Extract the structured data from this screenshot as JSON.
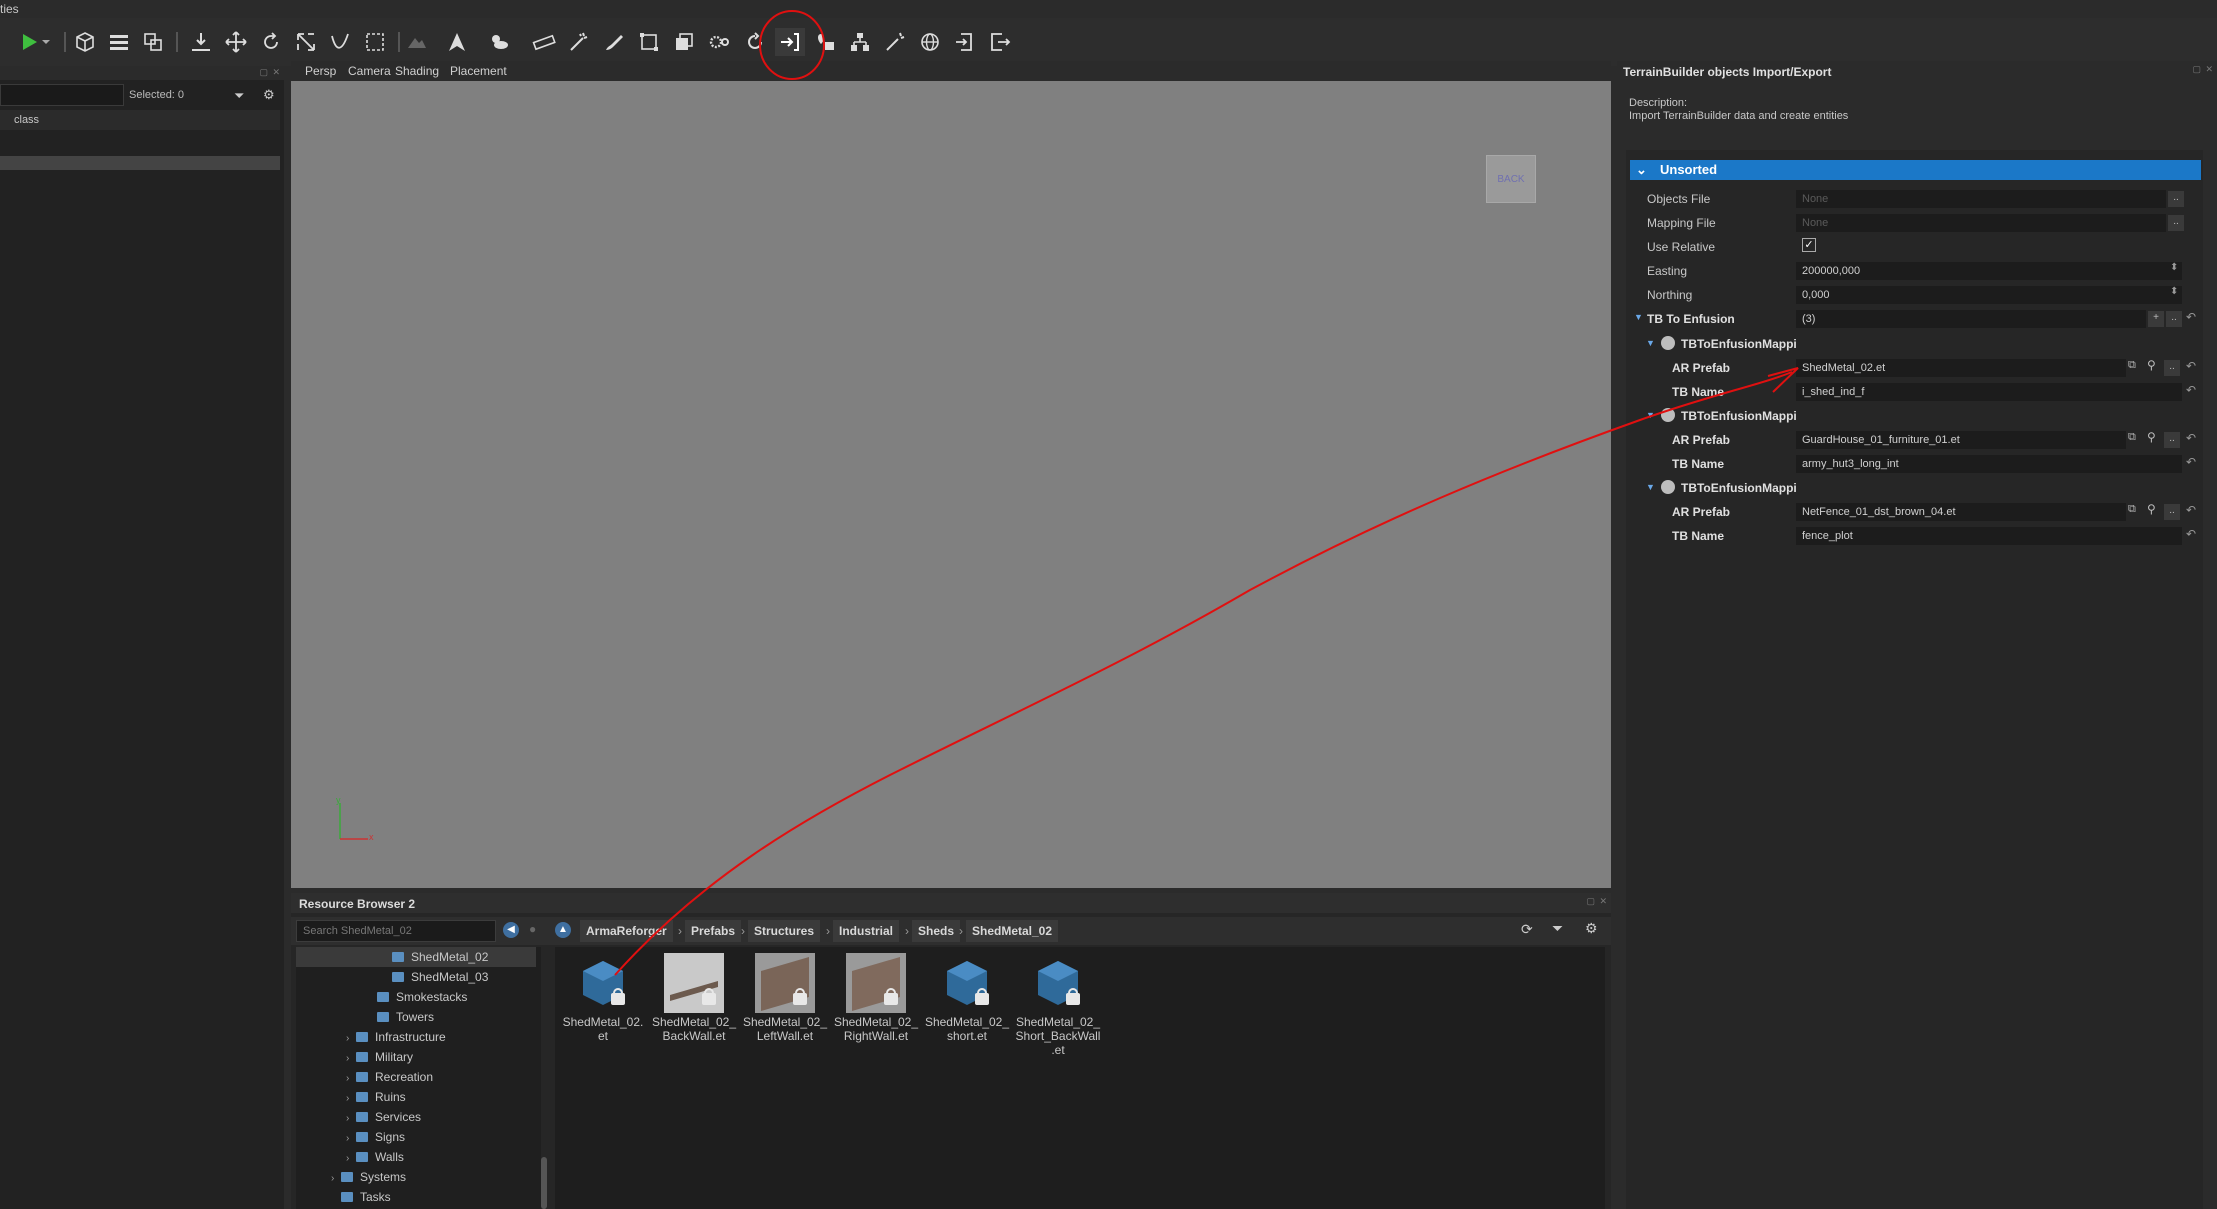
{
  "app": {
    "title_fragment": "ties"
  },
  "colors": {
    "accent": "#1b78c8",
    "annotation": "#e01010",
    "viewport_bg": "#808080"
  },
  "outliner": {
    "selected_label": "Selected: 0",
    "column_header": "class"
  },
  "viewport": {
    "tabs": [
      "Persp",
      "Camera",
      "Shading",
      "Placement"
    ],
    "navcube_label": "BACK",
    "axis_y": "y",
    "axis_x": "x"
  },
  "resource_browser": {
    "title": "Resource Browser 2",
    "search_placeholder": "Search ShedMetal_02",
    "breadcrumb": [
      "ArmaReforger",
      "Prefabs",
      "Structures",
      "Industrial",
      "Sheds",
      "ShedMetal_02"
    ],
    "tree": [
      {
        "label": "ShedMetal_02",
        "selected": true
      },
      {
        "label": "ShedMetal_03"
      },
      {
        "label": "Smokestacks"
      },
      {
        "label": "Towers"
      },
      {
        "label": "Infrastructure"
      },
      {
        "label": "Military"
      },
      {
        "label": "Recreation"
      },
      {
        "label": "Ruins"
      },
      {
        "label": "Services"
      },
      {
        "label": "Signs"
      },
      {
        "label": "Walls"
      },
      {
        "label": "Systems"
      },
      {
        "label": "Tasks"
      }
    ],
    "assets": [
      {
        "line1": "ShedMetal_02.",
        "line2": "et",
        "line3": "",
        "icon": "prefab-cube-icon"
      },
      {
        "line1": "ShedMetal_02_",
        "line2": "BackWall.et",
        "line3": "",
        "icon": "wall-thumbnail"
      },
      {
        "line1": "ShedMetal_02_",
        "line2": "LeftWall.et",
        "line3": "",
        "icon": "wall-thumbnail"
      },
      {
        "line1": "ShedMetal_02_",
        "line2": "RightWall.et",
        "line3": "",
        "icon": "wall-thumbnail"
      },
      {
        "line1": "ShedMetal_02_",
        "line2": "short.et",
        "line3": "",
        "icon": "prefab-cube-icon"
      },
      {
        "line1": "ShedMetal_02_",
        "line2": "Short_BackWall",
        "line3": ".et",
        "icon": "prefab-cube-icon"
      }
    ]
  },
  "tb_panel": {
    "title": "TerrainBuilder objects Import/Export",
    "description_label": "Description:",
    "description_text": "Import TerrainBuilder data and create entities",
    "section": "Unsorted",
    "objects_file_label": "Objects File",
    "objects_file_value": "None",
    "mapping_file_label": "Mapping File",
    "mapping_file_value": "None",
    "use_relative_label": "Use Relative",
    "use_relative_checked": true,
    "easting_label": "Easting",
    "easting_value": "200000,000",
    "northing_label": "Northing",
    "northing_value": "0,000",
    "tb_to_enfusion_label": "TB To Enfusion",
    "tb_to_enfusion_count": "(3)",
    "mappings": [
      {
        "header": "TBToEnfusionMappi",
        "ar_label": "AR Prefab",
        "ar_value": "ShedMetal_02.et",
        "tb_label": "TB Name",
        "tb_value": "i_shed_ind_f"
      },
      {
        "header": "TBToEnfusionMappi",
        "ar_label": "AR Prefab",
        "ar_value": "GuardHouse_01_furniture_01.et",
        "tb_label": "TB Name",
        "tb_value": "army_hut3_long_int"
      },
      {
        "header": "TBToEnfusionMappi",
        "ar_label": "AR Prefab",
        "ar_value": "NetFence_01_dst_brown_04.et",
        "tb_label": "TB Name",
        "tb_value": "fence_plot"
      }
    ]
  }
}
